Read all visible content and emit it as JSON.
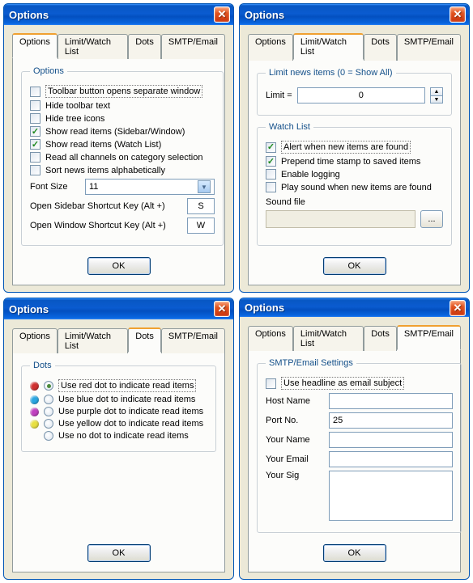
{
  "windows": [
    {
      "title": "Options",
      "tabs": {
        "options": "Options",
        "limit": "Limit/Watch List",
        "dots": "Dots",
        "smtp": "SMTP/Email"
      },
      "active": "options",
      "group": "Options",
      "checks": [
        {
          "label": "Toolbar button opens separate window",
          "checked": false,
          "focus": true
        },
        {
          "label": "Hide toolbar text",
          "checked": false
        },
        {
          "label": "Hide tree icons",
          "checked": false
        },
        {
          "label": "Show read items (Sidebar/Window)",
          "checked": true
        },
        {
          "label": "Show read items (Watch List)",
          "checked": true
        },
        {
          "label": "Read all channels on category selection",
          "checked": false
        },
        {
          "label": "Sort news items alphabetically",
          "checked": false
        }
      ],
      "font_label": "Font Size",
      "font_value": "11",
      "sidebar_key_label": "Open Sidebar Shortcut Key (Alt +)",
      "sidebar_key_value": "S",
      "window_key_label": "Open Window Shortcut Key (Alt +)",
      "window_key_value": "W",
      "ok": "OK"
    },
    {
      "title": "Options",
      "tabs": {
        "options": "Options",
        "limit": "Limit/Watch List",
        "dots": "Dots",
        "smtp": "SMTP/Email"
      },
      "active": "limit",
      "group_limit": "Limit news items (0 = Show All)",
      "limit_label": "Limit =",
      "limit_value": "0",
      "group_watch": "Watch List",
      "watch_checks": [
        {
          "label": "Alert when new items are found",
          "checked": true,
          "focus": true
        },
        {
          "label": "Prepend time stamp to saved items",
          "checked": true
        },
        {
          "label": "Enable logging",
          "checked": false
        },
        {
          "label": "Play sound when new items are found",
          "checked": false
        }
      ],
      "sound_label": "Sound file",
      "sound_value": "",
      "browse": "...",
      "ok": "OK"
    },
    {
      "title": "Options",
      "tabs": {
        "options": "Options",
        "limit": "Limit/Watch List",
        "dots": "Dots",
        "smtp": "SMTP/Email"
      },
      "active": "dots",
      "group": "Dots",
      "dot_options": [
        {
          "color": "#d03030",
          "label": "Use red dot to indicate read items",
          "selected": true,
          "focus": true
        },
        {
          "color": "#2aa6e2",
          "label": "Use blue dot to indicate read items",
          "selected": false
        },
        {
          "color": "#c040c0",
          "label": "Use purple dot to indicate read items",
          "selected": false
        },
        {
          "color": "#e8e040",
          "label": "Use yellow dot to indicate read items",
          "selected": false
        },
        {
          "color": "",
          "label": "Use no dot to indicate read items",
          "selected": false
        }
      ],
      "ok": "OK"
    },
    {
      "title": "Options",
      "tabs": {
        "options": "Options",
        "limit": "Limit/Watch List",
        "dots": "Dots",
        "smtp": "SMTP/Email"
      },
      "active": "smtp",
      "group": "SMTP/Email Settings",
      "headline_check": {
        "label": "Use headline as email subject",
        "checked": false,
        "focus": true
      },
      "fields": [
        {
          "label": "Host Name",
          "value": ""
        },
        {
          "label": "Port No.",
          "value": "25"
        },
        {
          "label": "Your Name",
          "value": ""
        },
        {
          "label": "Your Email",
          "value": ""
        }
      ],
      "sig_label": "Your Sig",
      "sig_value": "",
      "ok": "OK"
    }
  ]
}
